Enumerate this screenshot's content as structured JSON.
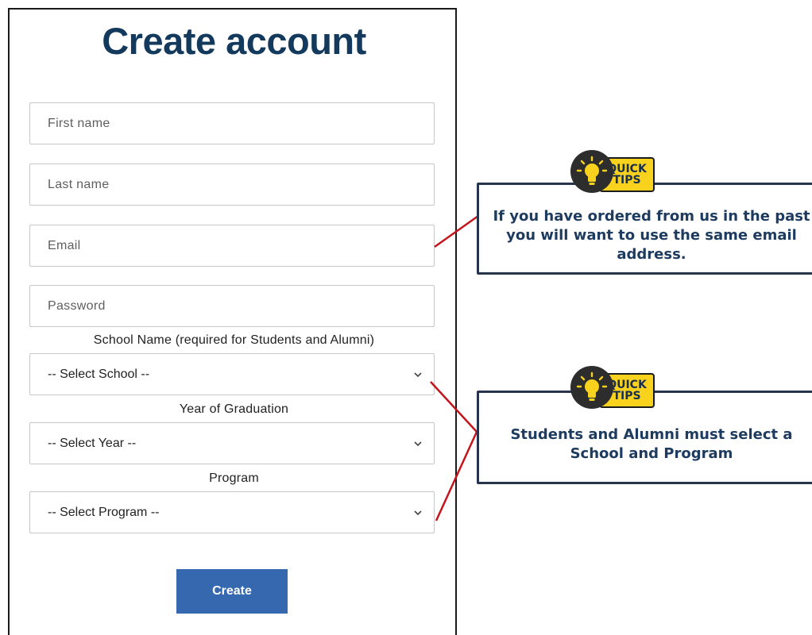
{
  "form": {
    "title": "Create account",
    "first_name_placeholder": "First name",
    "last_name_placeholder": "Last name",
    "email_placeholder": "Email",
    "password_placeholder": "Password",
    "school_label": "School Name (required for Students and Alumni)",
    "school_selected": "-- Select School --",
    "year_label": "Year of Graduation",
    "year_selected": "-- Select Year --",
    "program_label": "Program",
    "program_selected": "-- Select Program --",
    "create_label": "Create"
  },
  "tips": [
    {
      "badge_line1": "QUICK",
      "badge_line2": "TIPS",
      "text": "If you have ordered from us in the past you will want to use the same email address."
    },
    {
      "badge_line1": "QUICK",
      "badge_line2": "TIPS",
      "text": "Students and Alumni must select a School and Program"
    }
  ],
  "colors": {
    "title": "#133a5c",
    "button": "#3568ae",
    "tip_border": "#26344d",
    "tip_badge": "#f8d21d",
    "connector": "#c4151c"
  },
  "icons": {
    "select_arrow": "chevron-down-icon",
    "tip": "lightbulb-icon"
  }
}
